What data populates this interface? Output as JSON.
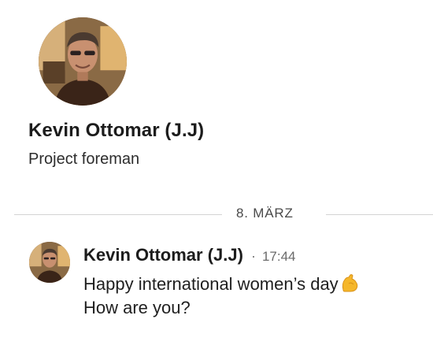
{
  "profile": {
    "name": "Kevin Ottomar (J.J)",
    "role": "Project foreman"
  },
  "divider": {
    "date": "8. MÄRZ"
  },
  "message": {
    "sender": "Kevin Ottomar (J.J)",
    "separator": "·",
    "time": "17:44",
    "line1": "Happy international women’s day",
    "line2": "How are you?",
    "emoji": "flexed-biceps"
  },
  "colors": {
    "text": "#1f1f1f",
    "secondary": "#6a6a6a",
    "divider": "#d4d4d4",
    "emoji": "#f5b72b"
  }
}
